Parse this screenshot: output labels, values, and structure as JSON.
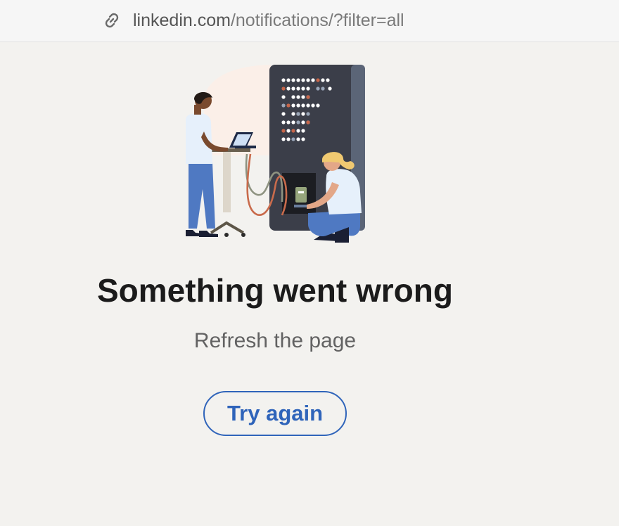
{
  "address_bar": {
    "host": "linkedin.com",
    "path": "/notifications/?filter=all",
    "icon": "link-icon"
  },
  "error": {
    "title": "Something went wrong",
    "subtitle": "Refresh the page",
    "retry_label": "Try again",
    "illustration": "server-repair-illustration"
  },
  "colors": {
    "background": "#f3f2ef",
    "accent": "#2f64ba",
    "title": "#1b1b1b",
    "subtitle": "#626262"
  }
}
